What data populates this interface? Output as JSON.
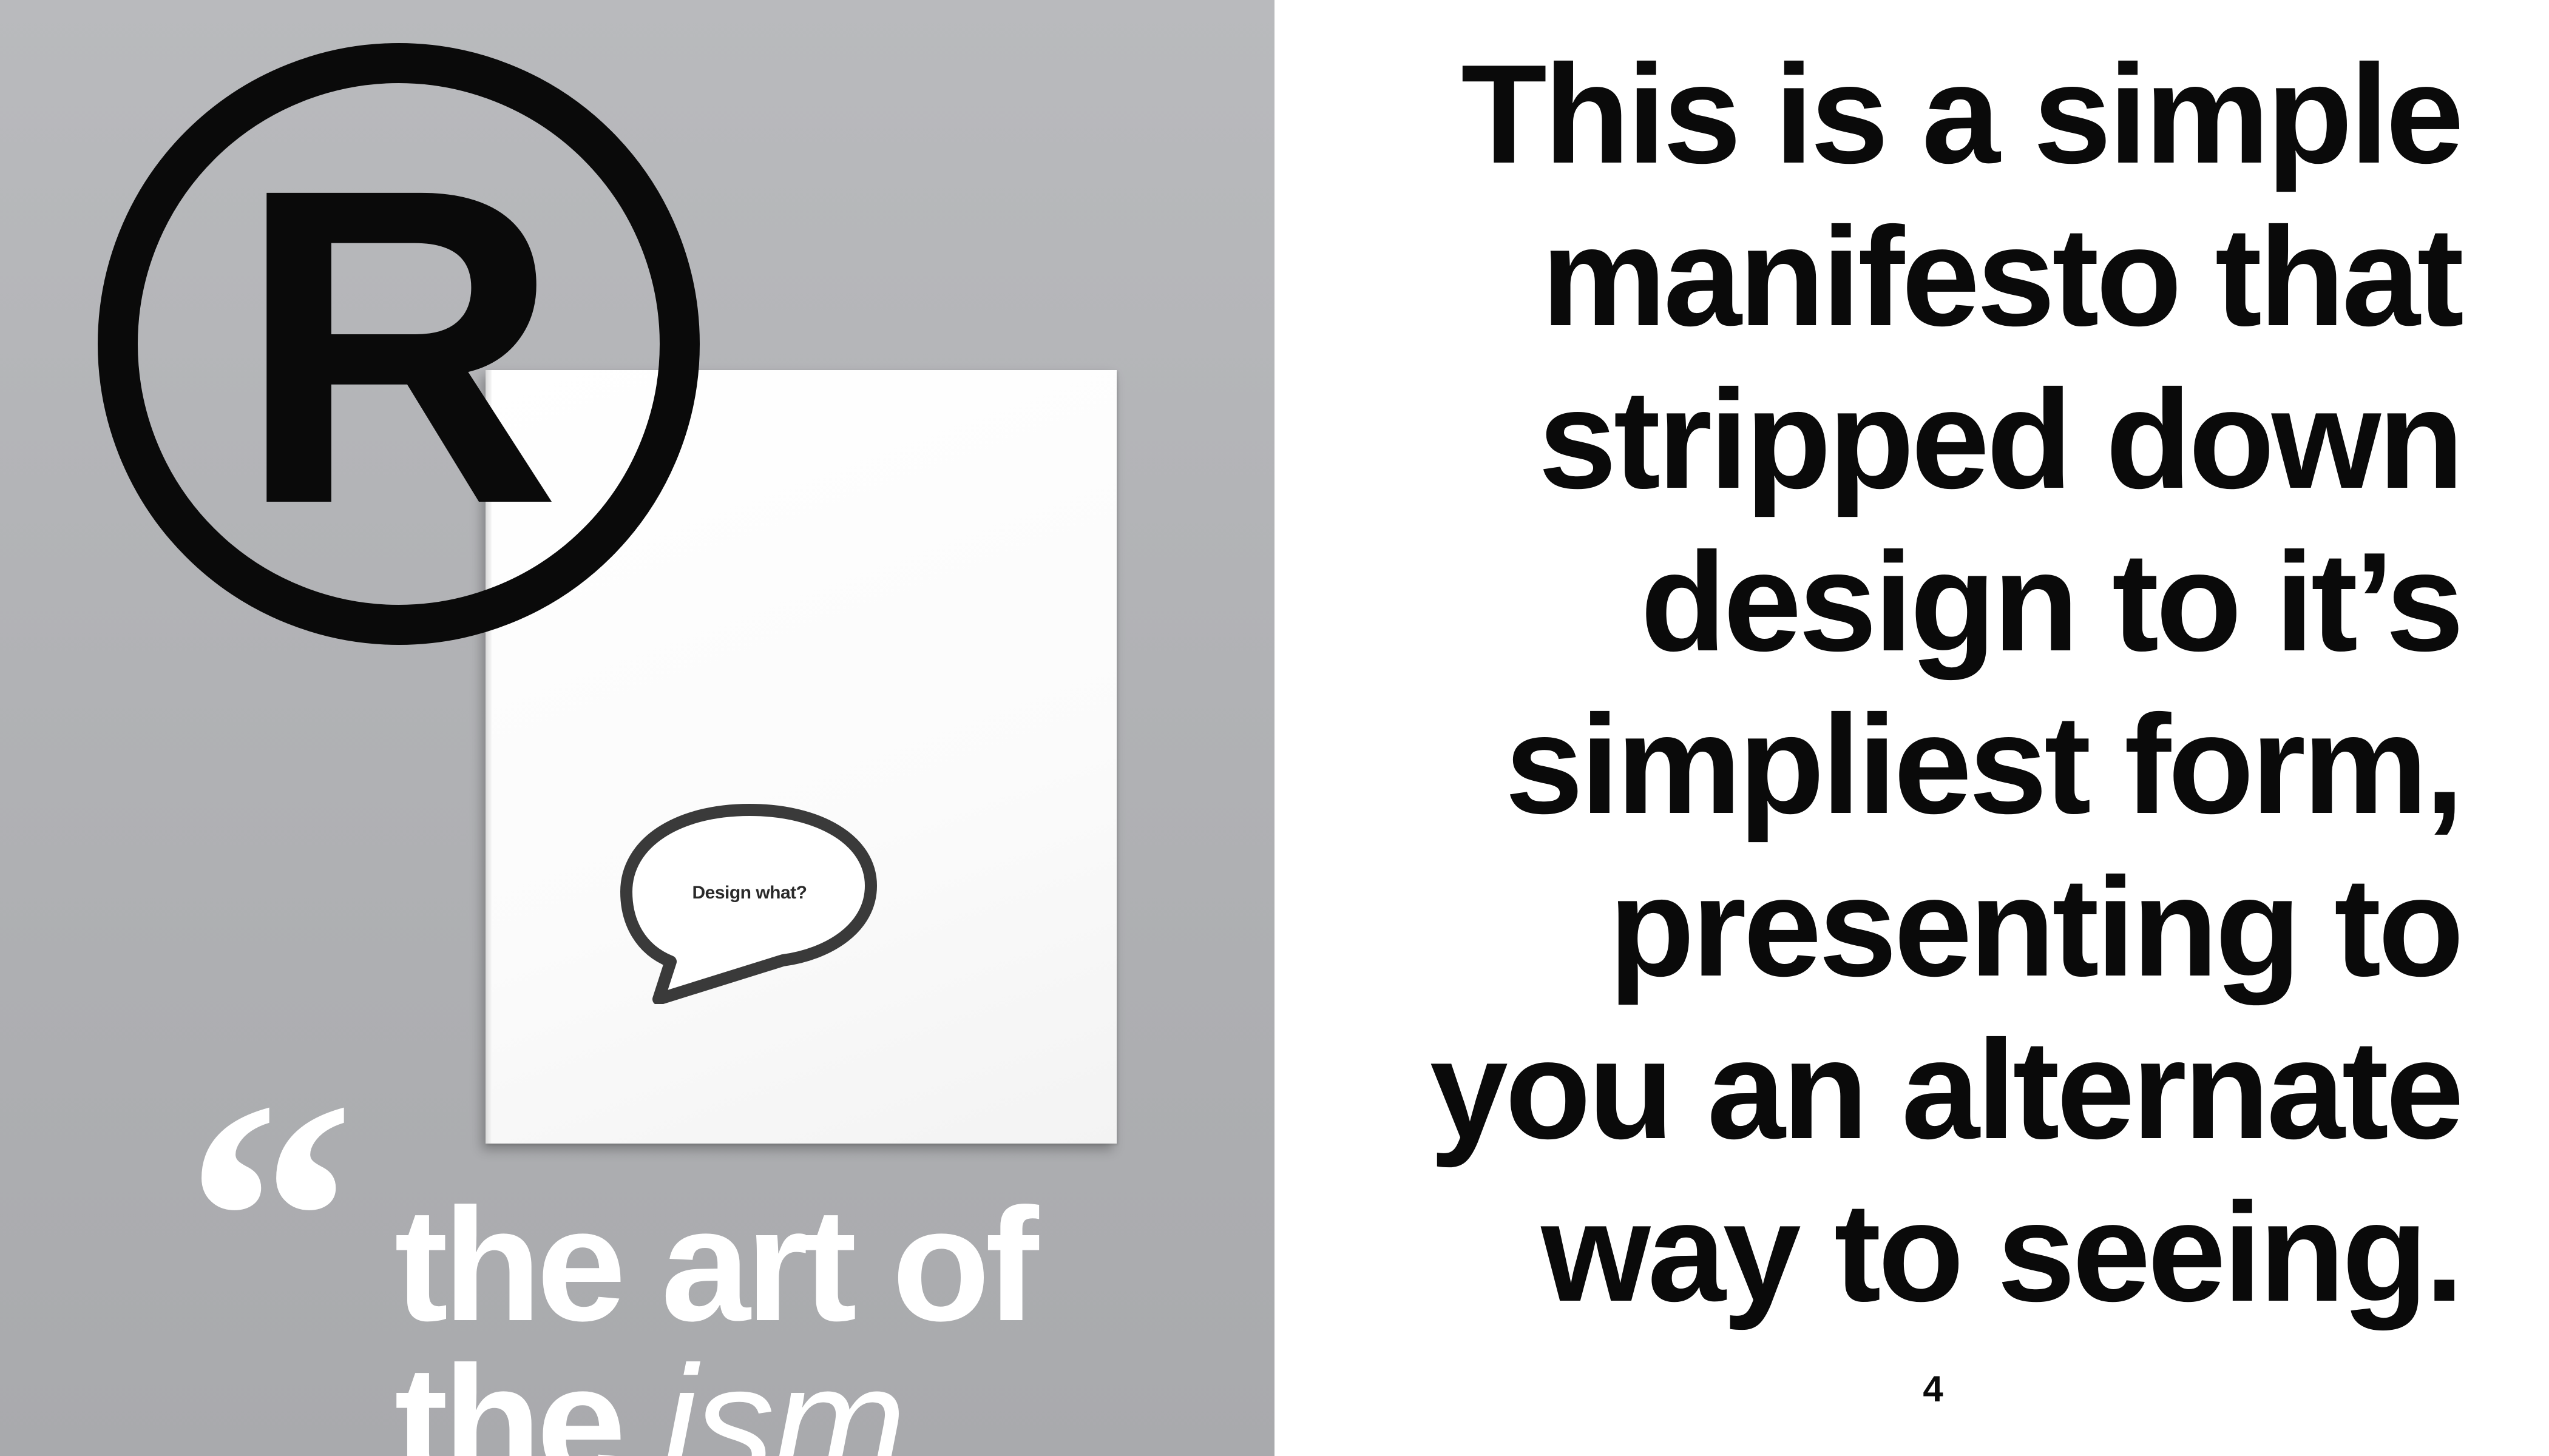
{
  "left_page": {
    "booklet": {
      "bubble_text": "Design what?"
    },
    "logo": {
      "icon": "registered-trademark-icon",
      "letter": "R"
    },
    "quote_mark": "“",
    "headline": {
      "line1": "the art of",
      "line2_prefix": "the ",
      "line2_italic": "ism"
    }
  },
  "right_page": {
    "manifesto_lines": [
      "This is a simple",
      "manifesto that",
      "stripped down",
      "design to it’s",
      "simpliest form,",
      "presenting to",
      "you an alternate",
      "way to seeing."
    ],
    "page_number": "4"
  },
  "colors": {
    "left_background": "#b5b6b9",
    "booklet": "#ffffff",
    "ink": "#0a0a0a",
    "headline_text": "#ffffff"
  }
}
